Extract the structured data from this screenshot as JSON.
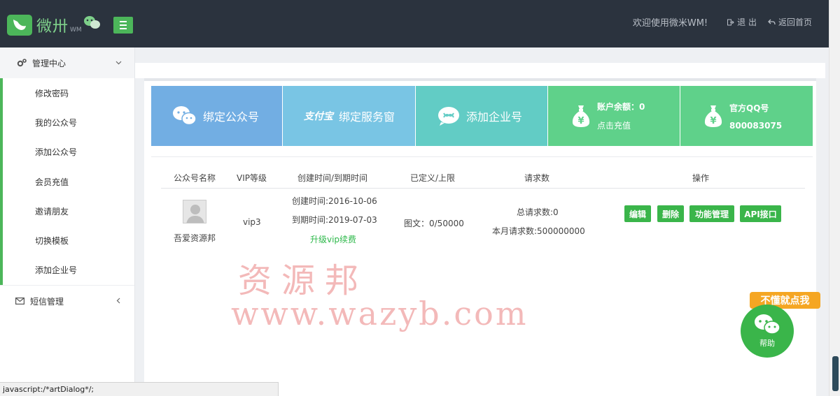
{
  "header": {
    "logo_text": "微卅",
    "logo_sub": "WM",
    "welcome": "欢迎使用微米WM!",
    "logout": "退 出",
    "home": "返回首页"
  },
  "sidebar": {
    "group1": {
      "title": "管理中心",
      "items": [
        {
          "label": "修改密码"
        },
        {
          "label": "我的公众号"
        },
        {
          "label": "添加公众号"
        },
        {
          "label": "会员充值"
        },
        {
          "label": "邀请朋友"
        },
        {
          "label": "切换模板"
        },
        {
          "label": "添加企业号"
        }
      ]
    },
    "group2": {
      "title": "短信管理"
    }
  },
  "cards": {
    "bind_mp": "绑定公众号",
    "bind_service_logo": "支付宝",
    "bind_service": "绑定服务窗",
    "add_enterprise": "添加企业号",
    "balance_label": "账户余额：0",
    "recharge": "点击充值",
    "qq_label": "官方QQ号",
    "qq_number": "800083075",
    "yen": "¥"
  },
  "table": {
    "headers": [
      "公众号名称",
      "VIP等级",
      "创建时间/到期时间",
      "已定义/上限",
      "请求数",
      "操作"
    ],
    "row": {
      "name": "吾爱资源邦",
      "vip": "vip3",
      "created": "创建时间:2016-10-06",
      "expires": "到期时间:2019-07-03",
      "upgrade": "升级vip续费",
      "defined": "图文：0/50000",
      "total_requests": "总请求数:0",
      "month_requests": "本月请求数:500000000",
      "actions": [
        "编辑",
        "删除",
        "功能管理",
        "API接口"
      ]
    }
  },
  "watermark": {
    "cn": "资源邦",
    "url": "www.wazyb.com"
  },
  "help": {
    "tag": "不懂就点我",
    "label": "帮助"
  },
  "statusbar": {
    "text": "javascript:/*artDialog*/;"
  },
  "colors": {
    "header_bg": "#2b333e",
    "accent_green": "#3ab54a",
    "card_blue": "#72aee3",
    "card_lightblue": "#79c5e4",
    "card_teal": "#62ccc5",
    "card_green": "#5fd18a",
    "help_orange": "#f5a623"
  }
}
